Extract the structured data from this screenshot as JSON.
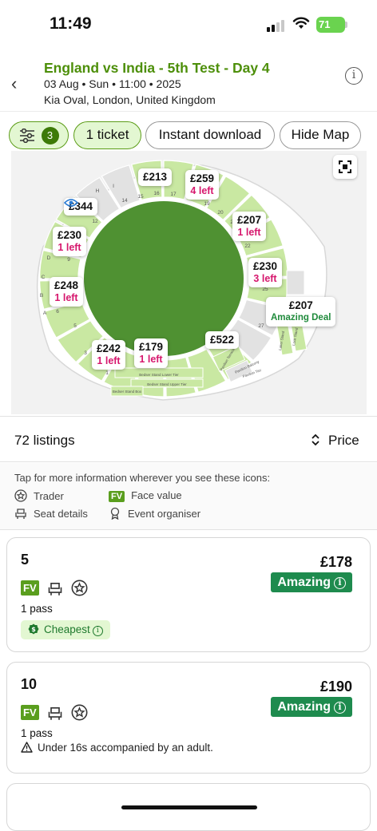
{
  "status_bar": {
    "time": "11:49",
    "battery": "71"
  },
  "event": {
    "title": "England vs India - 5th Test - Day 4",
    "date": "03 Aug • Sun • 11:00 • 2025",
    "venue": "Kia Oval, London, United Kingdom"
  },
  "filters": {
    "filter_count": "3",
    "ticket_label": "1 ticket",
    "instant_label": "Instant download",
    "hide_map_label": "Hide Map"
  },
  "map": {
    "colors": {
      "pitch": "#4f9132",
      "available": "#c9e8a2",
      "unavailable": "#e2e2e2"
    },
    "pins": [
      {
        "price": "£213",
        "note": ""
      },
      {
        "price": "£259",
        "note": "4 left"
      },
      {
        "price": "£344",
        "note": "",
        "icon": "eye-icon"
      },
      {
        "price": "£230",
        "note": "1 left"
      },
      {
        "price": "£207",
        "note": "1 left"
      },
      {
        "price": "£230",
        "note": "3 left"
      },
      {
        "price": "£248",
        "note": "1 left"
      },
      {
        "price": "£207",
        "note": "Amazing Deal"
      },
      {
        "price": "£522",
        "note": ""
      },
      {
        "price": "£242",
        "note": "1 left"
      },
      {
        "price": "£179",
        "note": "1 left"
      }
    ],
    "section_labels": [
      "14",
      "15",
      "16",
      "17",
      "18",
      "19",
      "20",
      "21",
      "22",
      "25",
      "27",
      "12",
      "9",
      "6",
      "5",
      "3",
      "1",
      "A",
      "B",
      "C",
      "D",
      "H",
      "I"
    ],
    "stand_labels": [
      "Bedser Stand Lower Tier",
      "Bedser Stand Upper Tier",
      "Pavilion Terrace",
      "Pavilion Balcony",
      "Pavilion Tier",
      "Laker Stand",
      "Lock Stand",
      "Bedser Stand Box"
    ]
  },
  "listings_bar": {
    "count": "72 listings",
    "sort_label": "Price"
  },
  "legend": {
    "title": "Tap for more information wherever you see these icons:",
    "items": [
      "Trader",
      "Face value",
      "Seat details",
      "Event organiser"
    ],
    "fv_badge": "FV"
  },
  "listings": [
    {
      "section": "5",
      "price": "£178",
      "deal": "Amazing",
      "qty": "1 pass",
      "tag": "Cheapest",
      "notice": ""
    },
    {
      "section": "10",
      "price": "£190",
      "deal": "Amazing",
      "qty": "1 pass",
      "tag": "",
      "notice": "Under 16s accompanied by an adult."
    }
  ]
}
